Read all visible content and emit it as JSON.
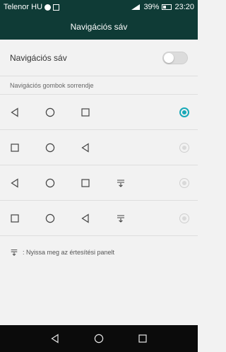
{
  "status_bar": {
    "carrier": "Telenor HU",
    "battery_percent": "39%",
    "time": "23:20",
    "icons": [
      "messenger-icon",
      "image-icon",
      "signal-icon",
      "battery-icon"
    ]
  },
  "titlebar": {
    "title": "Navigációs sáv"
  },
  "settings": {
    "toggle_label": "Navigációs sáv",
    "toggle_on": false,
    "section_header": "Navigációs gombok sorrendje",
    "options": [
      {
        "order": [
          "back-icon",
          "home-icon",
          "recents-icon"
        ],
        "selected": true
      },
      {
        "order": [
          "recents-icon",
          "home-icon",
          "back-icon"
        ],
        "selected": false
      },
      {
        "order": [
          "back-icon",
          "home-icon",
          "recents-icon",
          "notifications-icon"
        ],
        "selected": false
      },
      {
        "order": [
          "recents-icon",
          "home-icon",
          "back-icon",
          "notifications-icon"
        ],
        "selected": false
      }
    ],
    "footnote": ": Nyissa meg az értesítési panelt"
  },
  "colors": {
    "header_bg": "#0f3b36",
    "accent": "#17a9b8",
    "nav_bg": "#0b0b0b"
  }
}
